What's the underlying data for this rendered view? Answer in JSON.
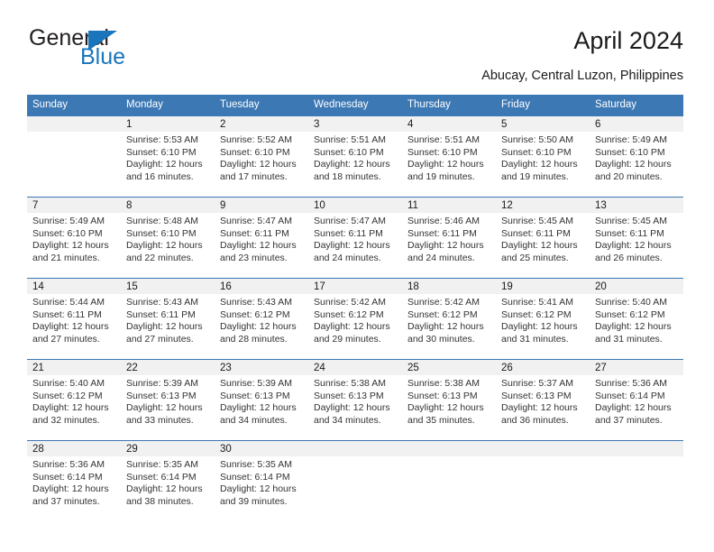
{
  "brand": {
    "name_part1": "General",
    "name_part2": "Blue",
    "flag_icon": "blue-triangle-flag-icon"
  },
  "header": {
    "title": "April 2024",
    "location": "Abucay, Central Luzon, Philippines"
  },
  "colors": {
    "header_blue": "#3c78b4",
    "brand_blue": "#1b75bb",
    "daynum_bg": "#f1f1f1",
    "page_bg": "#ffffff",
    "text": "#1a1a1a"
  },
  "weekday_headers": [
    "Sunday",
    "Monday",
    "Tuesday",
    "Wednesday",
    "Thursday",
    "Friday",
    "Saturday"
  ],
  "weeks": [
    [
      {
        "day": "",
        "sunrise": "",
        "sunset": "",
        "daylight1": "",
        "daylight2": "",
        "blank": true
      },
      {
        "day": "1",
        "sunrise": "Sunrise: 5:53 AM",
        "sunset": "Sunset: 6:10 PM",
        "daylight1": "Daylight: 12 hours",
        "daylight2": "and 16 minutes."
      },
      {
        "day": "2",
        "sunrise": "Sunrise: 5:52 AM",
        "sunset": "Sunset: 6:10 PM",
        "daylight1": "Daylight: 12 hours",
        "daylight2": "and 17 minutes."
      },
      {
        "day": "3",
        "sunrise": "Sunrise: 5:51 AM",
        "sunset": "Sunset: 6:10 PM",
        "daylight1": "Daylight: 12 hours",
        "daylight2": "and 18 minutes."
      },
      {
        "day": "4",
        "sunrise": "Sunrise: 5:51 AM",
        "sunset": "Sunset: 6:10 PM",
        "daylight1": "Daylight: 12 hours",
        "daylight2": "and 19 minutes."
      },
      {
        "day": "5",
        "sunrise": "Sunrise: 5:50 AM",
        "sunset": "Sunset: 6:10 PM",
        "daylight1": "Daylight: 12 hours",
        "daylight2": "and 19 minutes."
      },
      {
        "day": "6",
        "sunrise": "Sunrise: 5:49 AM",
        "sunset": "Sunset: 6:10 PM",
        "daylight1": "Daylight: 12 hours",
        "daylight2": "and 20 minutes."
      }
    ],
    [
      {
        "day": "7",
        "sunrise": "Sunrise: 5:49 AM",
        "sunset": "Sunset: 6:10 PM",
        "daylight1": "Daylight: 12 hours",
        "daylight2": "and 21 minutes."
      },
      {
        "day": "8",
        "sunrise": "Sunrise: 5:48 AM",
        "sunset": "Sunset: 6:10 PM",
        "daylight1": "Daylight: 12 hours",
        "daylight2": "and 22 minutes."
      },
      {
        "day": "9",
        "sunrise": "Sunrise: 5:47 AM",
        "sunset": "Sunset: 6:11 PM",
        "daylight1": "Daylight: 12 hours",
        "daylight2": "and 23 minutes."
      },
      {
        "day": "10",
        "sunrise": "Sunrise: 5:47 AM",
        "sunset": "Sunset: 6:11 PM",
        "daylight1": "Daylight: 12 hours",
        "daylight2": "and 24 minutes."
      },
      {
        "day": "11",
        "sunrise": "Sunrise: 5:46 AM",
        "sunset": "Sunset: 6:11 PM",
        "daylight1": "Daylight: 12 hours",
        "daylight2": "and 24 minutes."
      },
      {
        "day": "12",
        "sunrise": "Sunrise: 5:45 AM",
        "sunset": "Sunset: 6:11 PM",
        "daylight1": "Daylight: 12 hours",
        "daylight2": "and 25 minutes."
      },
      {
        "day": "13",
        "sunrise": "Sunrise: 5:45 AM",
        "sunset": "Sunset: 6:11 PM",
        "daylight1": "Daylight: 12 hours",
        "daylight2": "and 26 minutes."
      }
    ],
    [
      {
        "day": "14",
        "sunrise": "Sunrise: 5:44 AM",
        "sunset": "Sunset: 6:11 PM",
        "daylight1": "Daylight: 12 hours",
        "daylight2": "and 27 minutes."
      },
      {
        "day": "15",
        "sunrise": "Sunrise: 5:43 AM",
        "sunset": "Sunset: 6:11 PM",
        "daylight1": "Daylight: 12 hours",
        "daylight2": "and 27 minutes."
      },
      {
        "day": "16",
        "sunrise": "Sunrise: 5:43 AM",
        "sunset": "Sunset: 6:12 PM",
        "daylight1": "Daylight: 12 hours",
        "daylight2": "and 28 minutes."
      },
      {
        "day": "17",
        "sunrise": "Sunrise: 5:42 AM",
        "sunset": "Sunset: 6:12 PM",
        "daylight1": "Daylight: 12 hours",
        "daylight2": "and 29 minutes."
      },
      {
        "day": "18",
        "sunrise": "Sunrise: 5:42 AM",
        "sunset": "Sunset: 6:12 PM",
        "daylight1": "Daylight: 12 hours",
        "daylight2": "and 30 minutes."
      },
      {
        "day": "19",
        "sunrise": "Sunrise: 5:41 AM",
        "sunset": "Sunset: 6:12 PM",
        "daylight1": "Daylight: 12 hours",
        "daylight2": "and 31 minutes."
      },
      {
        "day": "20",
        "sunrise": "Sunrise: 5:40 AM",
        "sunset": "Sunset: 6:12 PM",
        "daylight1": "Daylight: 12 hours",
        "daylight2": "and 31 minutes."
      }
    ],
    [
      {
        "day": "21",
        "sunrise": "Sunrise: 5:40 AM",
        "sunset": "Sunset: 6:12 PM",
        "daylight1": "Daylight: 12 hours",
        "daylight2": "and 32 minutes."
      },
      {
        "day": "22",
        "sunrise": "Sunrise: 5:39 AM",
        "sunset": "Sunset: 6:13 PM",
        "daylight1": "Daylight: 12 hours",
        "daylight2": "and 33 minutes."
      },
      {
        "day": "23",
        "sunrise": "Sunrise: 5:39 AM",
        "sunset": "Sunset: 6:13 PM",
        "daylight1": "Daylight: 12 hours",
        "daylight2": "and 34 minutes."
      },
      {
        "day": "24",
        "sunrise": "Sunrise: 5:38 AM",
        "sunset": "Sunset: 6:13 PM",
        "daylight1": "Daylight: 12 hours",
        "daylight2": "and 34 minutes."
      },
      {
        "day": "25",
        "sunrise": "Sunrise: 5:38 AM",
        "sunset": "Sunset: 6:13 PM",
        "daylight1": "Daylight: 12 hours",
        "daylight2": "and 35 minutes."
      },
      {
        "day": "26",
        "sunrise": "Sunrise: 5:37 AM",
        "sunset": "Sunset: 6:13 PM",
        "daylight1": "Daylight: 12 hours",
        "daylight2": "and 36 minutes."
      },
      {
        "day": "27",
        "sunrise": "Sunrise: 5:36 AM",
        "sunset": "Sunset: 6:14 PM",
        "daylight1": "Daylight: 12 hours",
        "daylight2": "and 37 minutes."
      }
    ],
    [
      {
        "day": "28",
        "sunrise": "Sunrise: 5:36 AM",
        "sunset": "Sunset: 6:14 PM",
        "daylight1": "Daylight: 12 hours",
        "daylight2": "and 37 minutes."
      },
      {
        "day": "29",
        "sunrise": "Sunrise: 5:35 AM",
        "sunset": "Sunset: 6:14 PM",
        "daylight1": "Daylight: 12 hours",
        "daylight2": "and 38 minutes."
      },
      {
        "day": "30",
        "sunrise": "Sunrise: 5:35 AM",
        "sunset": "Sunset: 6:14 PM",
        "daylight1": "Daylight: 12 hours",
        "daylight2": "and 39 minutes."
      },
      {
        "day": "",
        "sunrise": "",
        "sunset": "",
        "daylight1": "",
        "daylight2": "",
        "blank": true
      },
      {
        "day": "",
        "sunrise": "",
        "sunset": "",
        "daylight1": "",
        "daylight2": "",
        "blank": true
      },
      {
        "day": "",
        "sunrise": "",
        "sunset": "",
        "daylight1": "",
        "daylight2": "",
        "blank": true
      },
      {
        "day": "",
        "sunrise": "",
        "sunset": "",
        "daylight1": "",
        "daylight2": "",
        "blank": true
      }
    ]
  ]
}
